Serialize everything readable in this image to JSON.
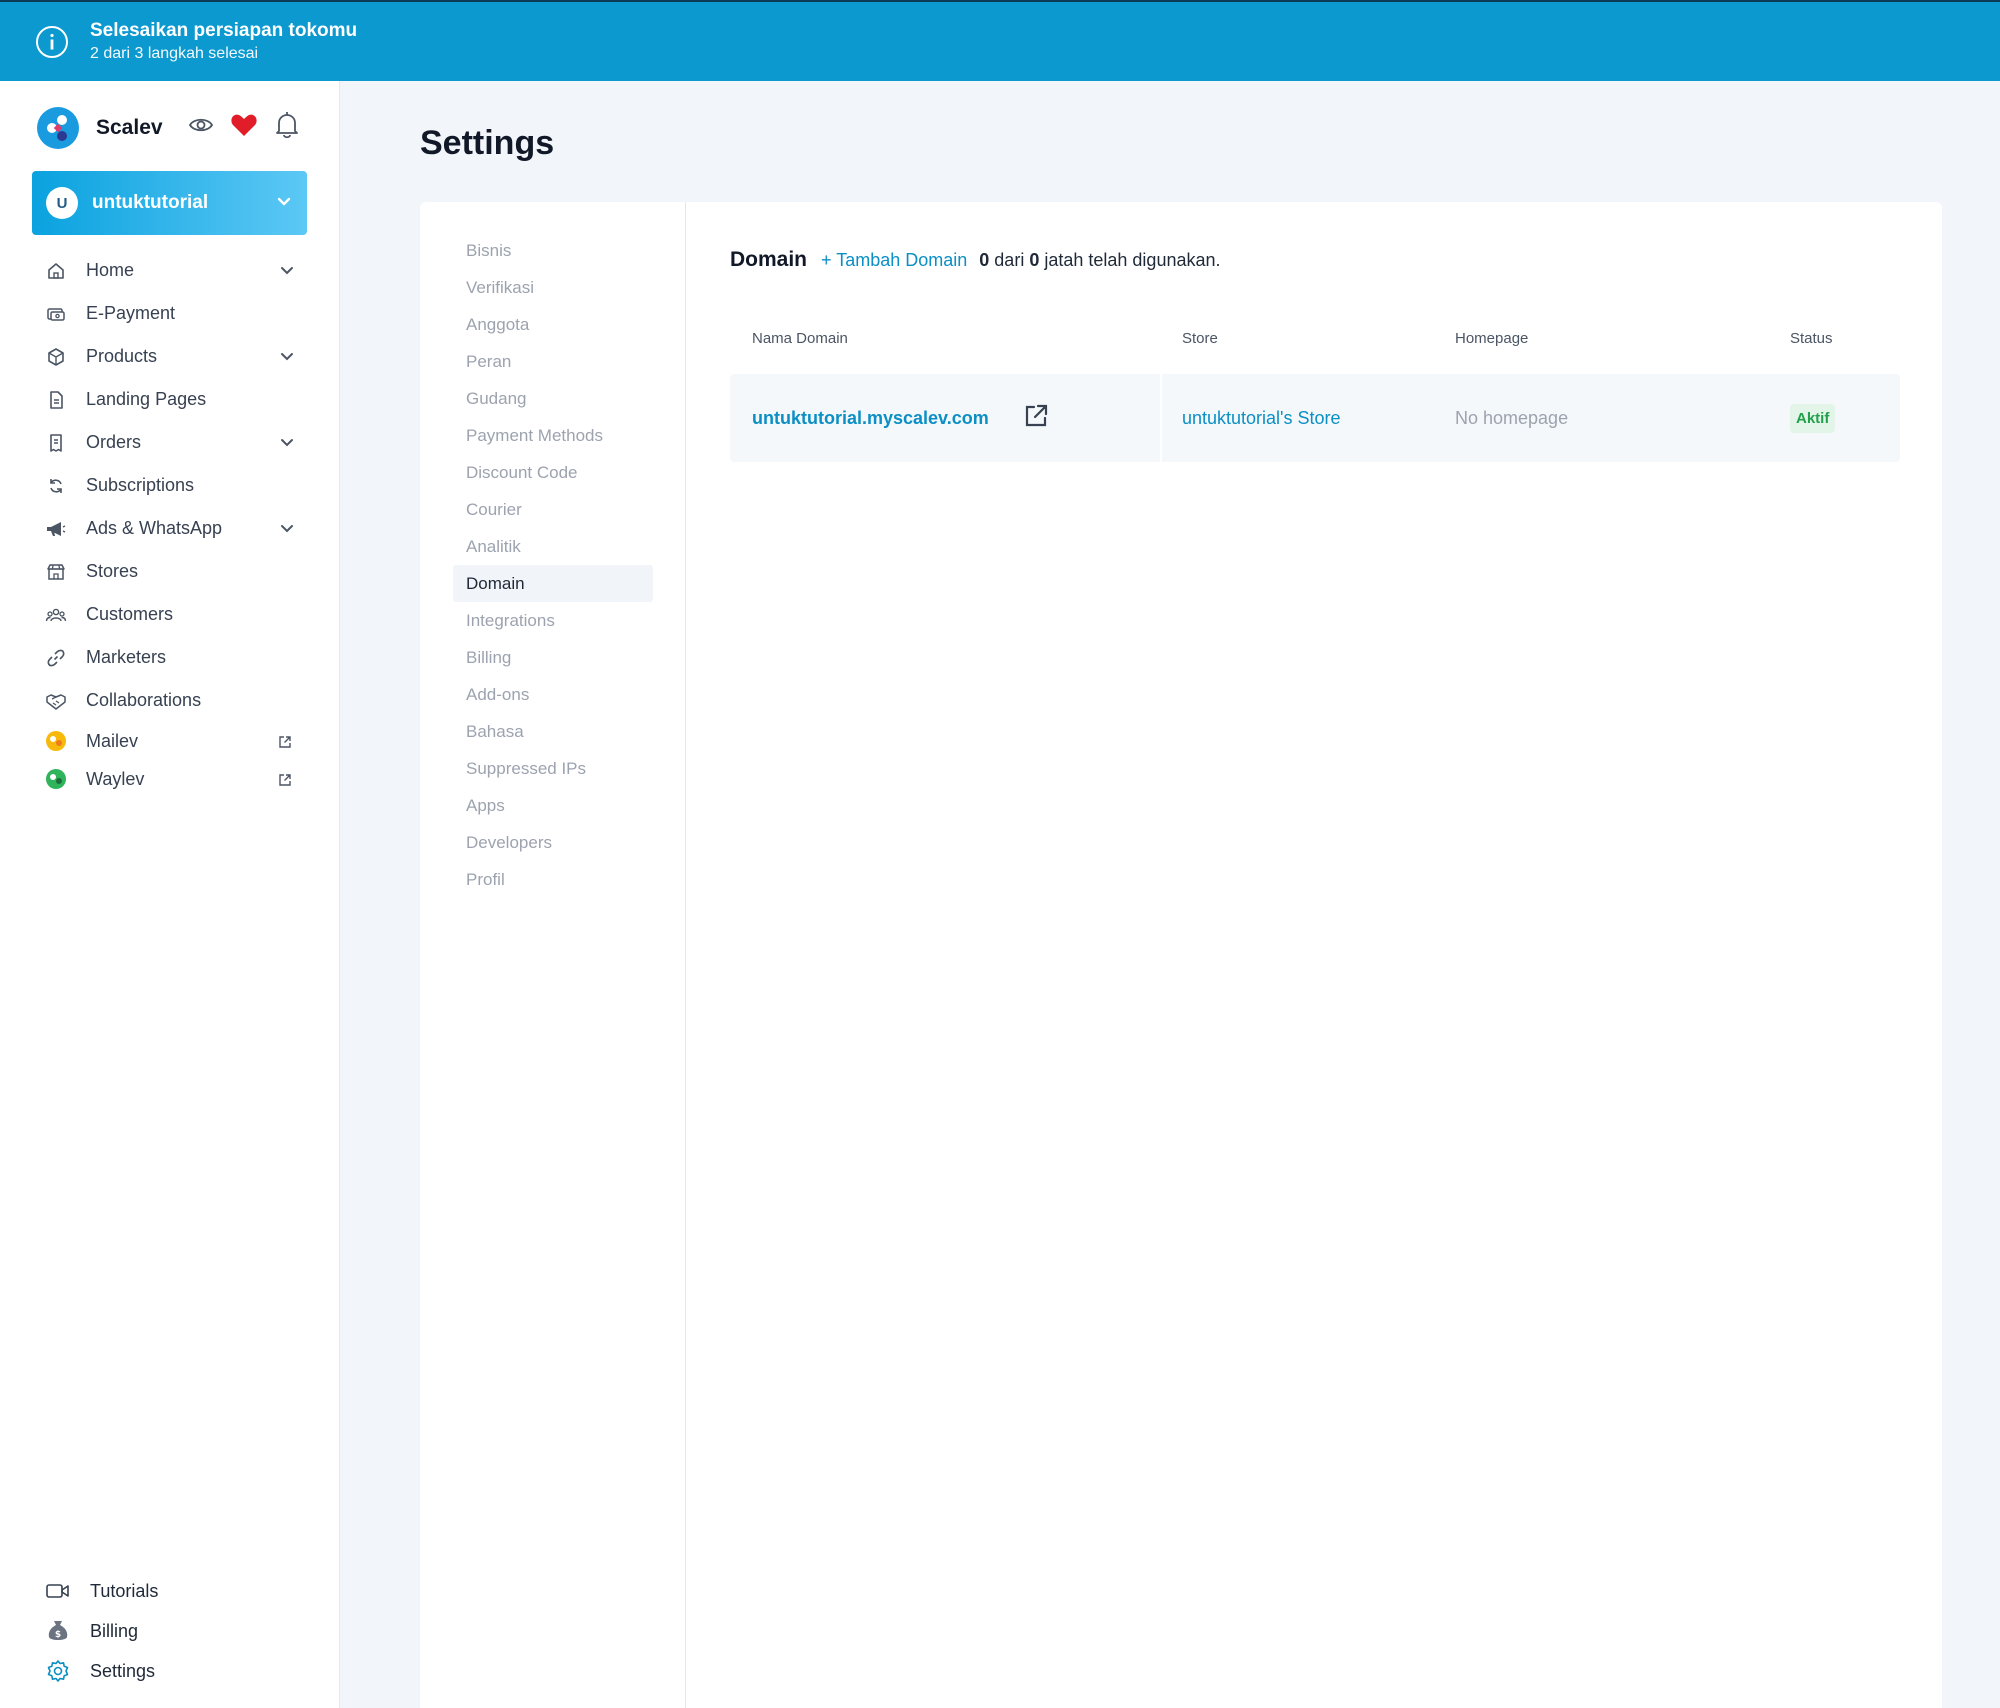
{
  "banner": {
    "icon": "info-icon",
    "title": "Selesaikan persiapan tokomu",
    "subtitle": "2 dari 3 langkah selesai",
    "color": "#0b99cf"
  },
  "brand": {
    "name": "Scalev",
    "icons": [
      "eye-icon",
      "heart-icon",
      "bell-icon"
    ]
  },
  "store_selector": {
    "avatar_letter": "U",
    "label": "untuktutorial"
  },
  "sidebar": {
    "items": [
      {
        "label": "Home",
        "icon": "home-icon",
        "expandable": true
      },
      {
        "label": "E-Payment",
        "icon": "payment-icon",
        "expandable": false
      },
      {
        "label": "Products",
        "icon": "box-icon",
        "expandable": true
      },
      {
        "label": "Landing Pages",
        "icon": "page-icon",
        "expandable": false
      },
      {
        "label": "Orders",
        "icon": "receipt-icon",
        "expandable": true
      },
      {
        "label": "Subscriptions",
        "icon": "refresh-icon",
        "expandable": false
      },
      {
        "label": "Ads & WhatsApp",
        "icon": "megaphone-icon",
        "expandable": true
      },
      {
        "label": "Stores",
        "icon": "store-icon",
        "expandable": false
      },
      {
        "label": "Customers",
        "icon": "users-icon",
        "expandable": false
      },
      {
        "label": "Marketers",
        "icon": "link-icon",
        "expandable": false
      },
      {
        "label": "Collaborations",
        "icon": "handshake-icon",
        "expandable": false
      },
      {
        "label": "Mailev",
        "icon": "mailev-logo-icon",
        "external": true
      },
      {
        "label": "Waylev",
        "icon": "waylev-logo-icon",
        "external": true
      }
    ],
    "bottom": [
      {
        "label": "Tutorials",
        "icon": "video-icon"
      },
      {
        "label": "Billing",
        "icon": "money-bag-icon"
      },
      {
        "label": "Settings",
        "icon": "gear-icon"
      }
    ]
  },
  "page": {
    "title": "Settings"
  },
  "settings_menu": {
    "items": [
      "Bisnis",
      "Verifikasi",
      "Anggota",
      "Peran",
      "Gudang",
      "Payment Methods",
      "Discount Code",
      "Courier",
      "Analitik",
      "Domain",
      "Integrations",
      "Billing",
      "Add-ons",
      "Bahasa",
      "Suppressed IPs",
      "Apps",
      "Developers",
      "Profil"
    ],
    "active": "Domain"
  },
  "domain": {
    "heading": "Domain",
    "add_label": "+ Tambah Domain",
    "used": "0",
    "dari": "dari",
    "quota": "0",
    "usage_suffix": "jatah telah digunakan.",
    "columns": [
      "Nama Domain",
      "Store",
      "Homepage",
      "Status"
    ],
    "rows": [
      {
        "domain": "untuktutorial.myscalev.com",
        "store": "untuktutorial's Store",
        "homepage": "No homepage",
        "status": "Aktif"
      }
    ]
  },
  "colors": {
    "accent": "#0b8fc4",
    "status_active_bg": "#e3f5e8",
    "status_active_text": "#22a04b",
    "heart": "#e11d2a"
  }
}
